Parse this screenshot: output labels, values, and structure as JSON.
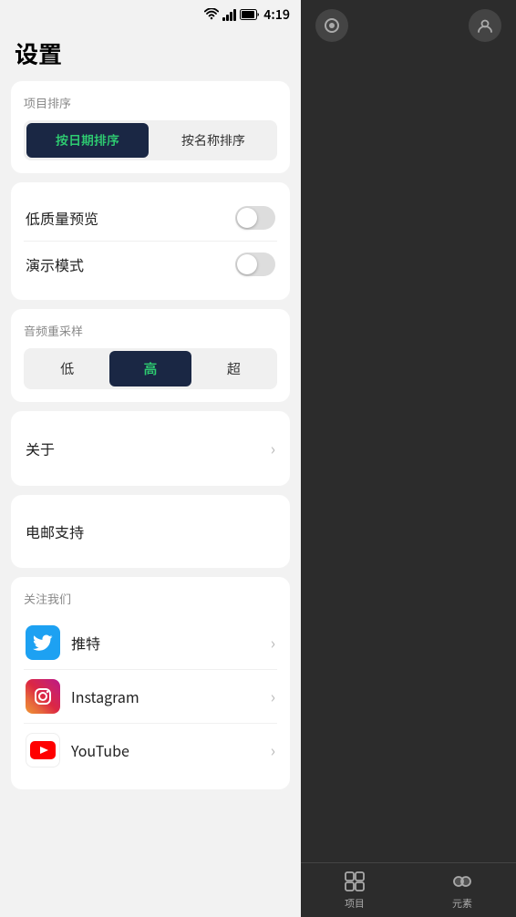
{
  "statusBar": {
    "time": "4:19"
  },
  "pageTitle": "设置",
  "sortSection": {
    "label": "项目排序",
    "btn1": "按日期排序",
    "btn2": "按名称排序",
    "active": 0
  },
  "toggleSection": {
    "toggle1Label": "低质量预览",
    "toggle2Label": "演示模式"
  },
  "resampleSection": {
    "label": "音频重采样",
    "options": [
      "低",
      "高",
      "超"
    ],
    "active": 1
  },
  "aboutSection": {
    "label": "关于"
  },
  "emailSection": {
    "label": "电邮支持"
  },
  "followSection": {
    "sectionLabel": "关注我们",
    "items": [
      {
        "name": "推特",
        "platform": "twitter"
      },
      {
        "name": "Instagram",
        "platform": "instagram"
      },
      {
        "name": "YouTube",
        "platform": "youtube"
      }
    ]
  },
  "bottomNav": {
    "items": [
      {
        "label": "项目",
        "icon": "grid"
      },
      {
        "label": "元素",
        "icon": "layers"
      }
    ]
  }
}
